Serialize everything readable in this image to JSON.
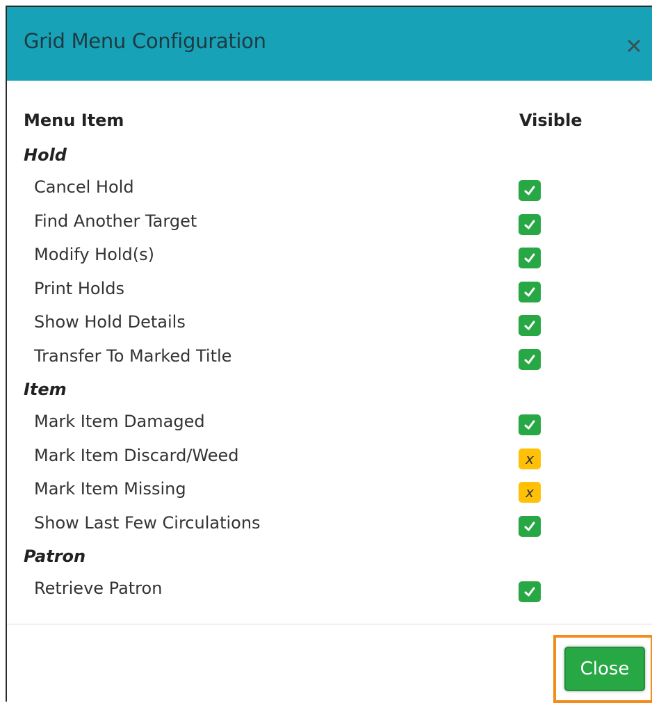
{
  "dialog": {
    "title": "Grid Menu Configuration",
    "close_icon": "close-icon",
    "colors": {
      "header": "#17a2b8",
      "visible_on": "#28a745",
      "visible_off": "#ffc107",
      "focus_outline": "#f28c1d"
    }
  },
  "columns": {
    "menu_item": "Menu Item",
    "visible": "Visible"
  },
  "groups": [
    {
      "title": "Hold",
      "items": [
        {
          "label": "Cancel Hold",
          "visible": true,
          "glyph": "check-icon"
        },
        {
          "label": "Find Another Target",
          "visible": true,
          "glyph": "check-icon"
        },
        {
          "label": "Modify Hold(s)",
          "visible": true,
          "glyph": "check-icon"
        },
        {
          "label": "Print Holds",
          "visible": true,
          "glyph": "check-icon"
        },
        {
          "label": "Show Hold Details",
          "visible": true,
          "glyph": "check-icon"
        },
        {
          "label": "Transfer To Marked Title",
          "visible": true,
          "glyph": "check-icon"
        }
      ]
    },
    {
      "title": "Item",
      "items": [
        {
          "label": "Mark Item Damaged",
          "visible": true,
          "glyph": "check-icon"
        },
        {
          "label": "Mark Item Discard/Weed",
          "visible": false,
          "glyph": "x"
        },
        {
          "label": "Mark Item Missing",
          "visible": false,
          "glyph": "x"
        },
        {
          "label": "Show Last Few Circulations",
          "visible": true,
          "glyph": "check-icon"
        }
      ]
    },
    {
      "title": "Patron",
      "items": [
        {
          "label": "Retrieve Patron",
          "visible": true,
          "glyph": "check-icon"
        }
      ]
    }
  ],
  "footer": {
    "close_label": "Close"
  }
}
